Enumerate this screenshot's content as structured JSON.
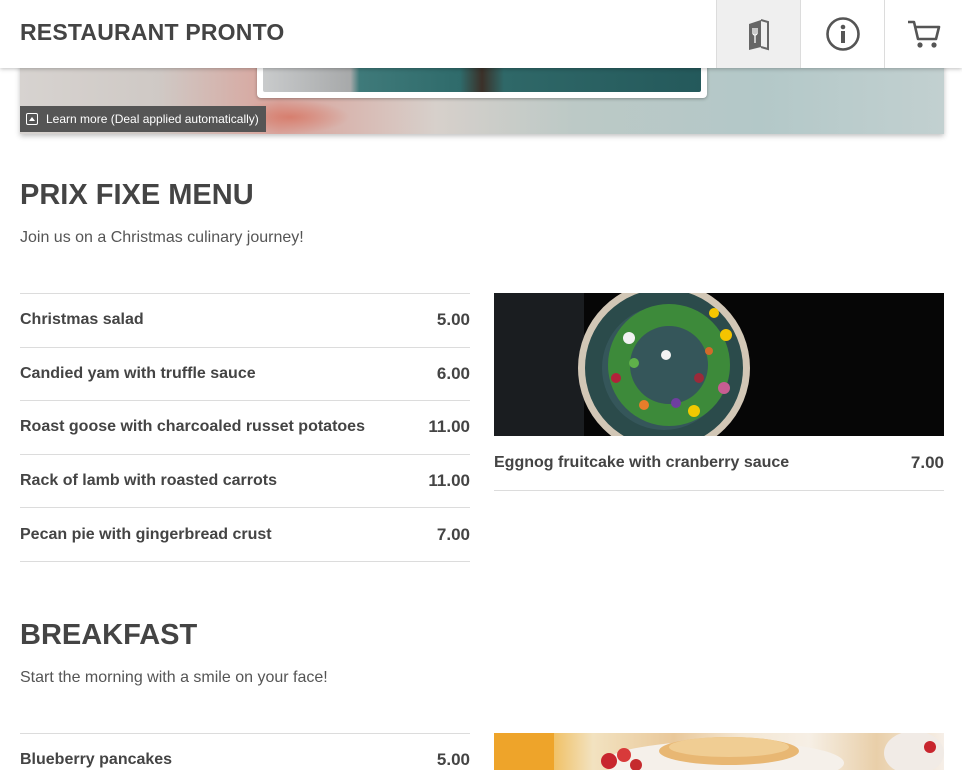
{
  "header": {
    "brand": "RESTAURANT PRONTO",
    "buttons": [
      {
        "icon": "menu-book-icon",
        "active": true
      },
      {
        "icon": "info-icon",
        "active": false
      },
      {
        "icon": "cart-icon",
        "active": false
      }
    ]
  },
  "banner": {
    "learn_more": "Learn more (Deal applied automatically)"
  },
  "prix_fixe": {
    "title": "PRIX FIXE MENU",
    "subtitle": "Join us on a Christmas culinary journey!",
    "items": [
      {
        "name": "Christmas salad",
        "price": "5.00"
      },
      {
        "name": "Candied yam with truffle sauce",
        "price": "6.00"
      },
      {
        "name": "Roast goose with charcoaled russet potatoes",
        "price": "11.00"
      },
      {
        "name": "Rack of lamb with roasted carrots",
        "price": "11.00"
      },
      {
        "name": "Pecan pie with gingerbread crust",
        "price": "7.00"
      }
    ],
    "featured": {
      "name": "Eggnog fruitcake with cranberry sauce",
      "price": "7.00"
    }
  },
  "breakfast": {
    "title": "BREAKFAST",
    "subtitle": "Start the morning with a smile on your face!",
    "items": [
      {
        "name": "Blueberry pancakes",
        "price": "5.00"
      }
    ]
  },
  "colors": {
    "text": "#444444",
    "divider": "#dcdcdc",
    "active_tab": "#efefef"
  }
}
